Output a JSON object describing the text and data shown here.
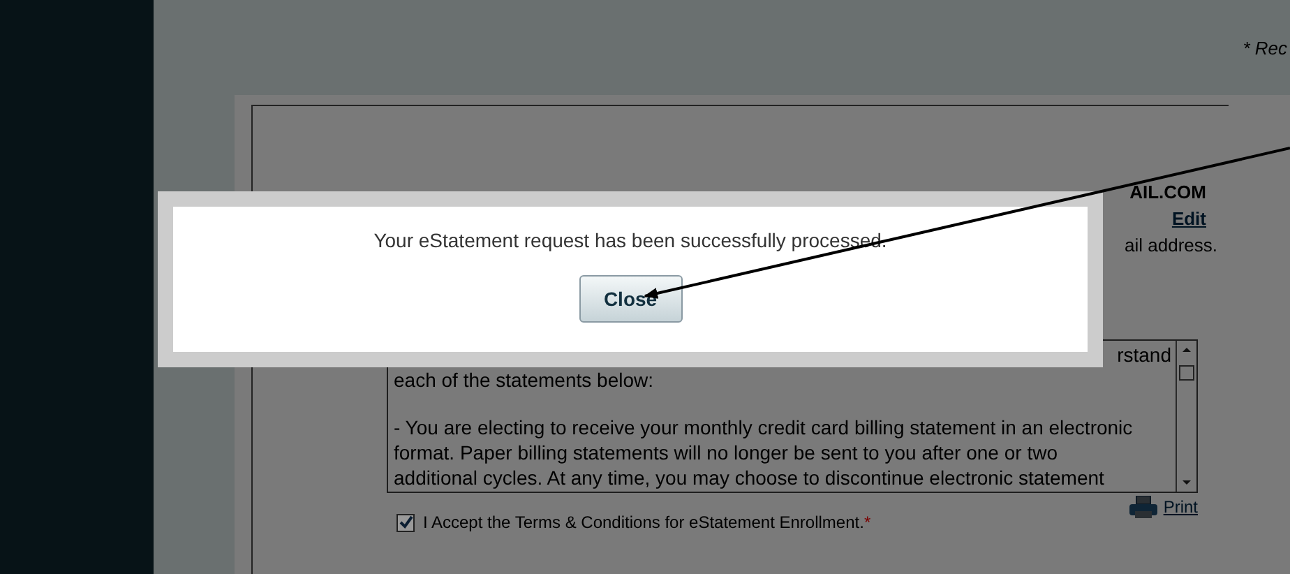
{
  "header": {
    "required_note": "* Rec"
  },
  "account": {
    "email": "AIL.COM",
    "edit_link": "Edit",
    "email_note": "ail address."
  },
  "terms": {
    "first_line": "rstand",
    "second_line": "each of the statements below:",
    "paragraph": "- You are electing to receive your monthly credit card billing statement in an electronic format. Paper billing statements will no longer be sent to you after one or two additional cycles. At any time, you may choose to discontinue electronic statement"
  },
  "print_link": "Print",
  "accept": {
    "label": "I Accept the Terms & Conditions for eStatement Enrollment.",
    "required_mark": "*",
    "checked": true
  },
  "modal": {
    "message": "Your eStatement request has been successfully processed.",
    "button": "Close"
  }
}
